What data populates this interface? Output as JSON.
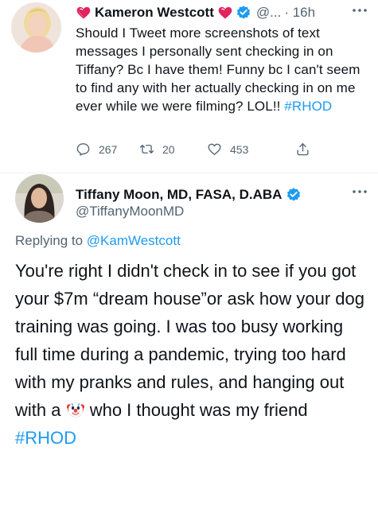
{
  "tweet1": {
    "display_name": "Kameron Westcott",
    "handle": "@...",
    "time": "· 16h",
    "more_label": "···",
    "text": "Should I Tweet more screenshots of text messages I personally sent checking in on Tiffany? Bc I have them! Funny bc I can't seem to find any with her actually checking in on me ever while we were filming? LOL!! ",
    "hashtag": "#RHOD",
    "stats": {
      "replies": "267",
      "retweets": "20",
      "likes": "453"
    },
    "icons": [
      "heart-emoji",
      "verified-badge",
      "more-icon",
      "reply-icon",
      "retweet-icon",
      "like-icon",
      "share-icon"
    ]
  },
  "tweet2": {
    "display_name": "Tiffany Moon, MD, FASA, D.ABA",
    "handle": "@TiffanyMoonMD",
    "more_label": "···",
    "replying_label": "Replying to ",
    "replying_handle": "@KamWestcott",
    "text_before_emoji": "You're right I didn't check in to see if you got your $7m “dream house”or ask how your dog training was going. I was too busy working full time during a pandemic, trying too hard with my pranks and rules, and hanging out with a ",
    "text_after_emoji": " who I thought was my friend",
    "hashtag": "#RHOD",
    "icons": [
      "verified-badge",
      "clown-emoji",
      "more-icon"
    ]
  },
  "colors": {
    "text": "#0f1419",
    "muted": "#536471",
    "link": "#1d9bf0",
    "verified": "#1d9bf0",
    "heart": "#e0245e"
  }
}
